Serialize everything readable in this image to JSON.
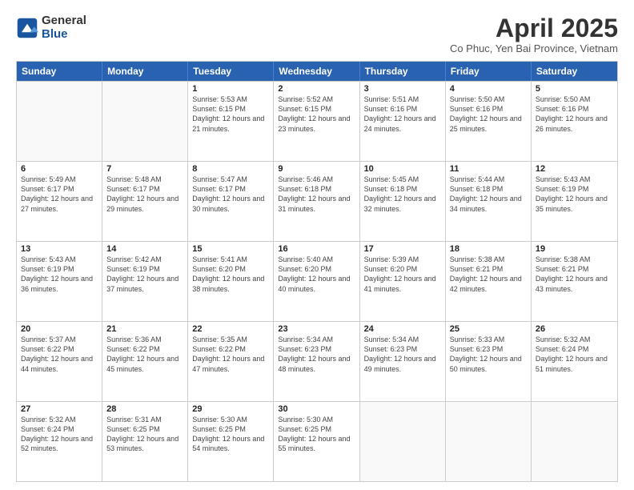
{
  "logo": {
    "general": "General",
    "blue": "Blue"
  },
  "title": "April 2025",
  "subtitle": "Co Phuc, Yen Bai Province, Vietnam",
  "headers": [
    "Sunday",
    "Monday",
    "Tuesday",
    "Wednesday",
    "Thursday",
    "Friday",
    "Saturday"
  ],
  "weeks": [
    [
      {
        "day": "",
        "info": ""
      },
      {
        "day": "",
        "info": ""
      },
      {
        "day": "1",
        "info": "Sunrise: 5:53 AM\nSunset: 6:15 PM\nDaylight: 12 hours and 21 minutes."
      },
      {
        "day": "2",
        "info": "Sunrise: 5:52 AM\nSunset: 6:15 PM\nDaylight: 12 hours and 23 minutes."
      },
      {
        "day": "3",
        "info": "Sunrise: 5:51 AM\nSunset: 6:16 PM\nDaylight: 12 hours and 24 minutes."
      },
      {
        "day": "4",
        "info": "Sunrise: 5:50 AM\nSunset: 6:16 PM\nDaylight: 12 hours and 25 minutes."
      },
      {
        "day": "5",
        "info": "Sunrise: 5:50 AM\nSunset: 6:16 PM\nDaylight: 12 hours and 26 minutes."
      }
    ],
    [
      {
        "day": "6",
        "info": "Sunrise: 5:49 AM\nSunset: 6:17 PM\nDaylight: 12 hours and 27 minutes."
      },
      {
        "day": "7",
        "info": "Sunrise: 5:48 AM\nSunset: 6:17 PM\nDaylight: 12 hours and 29 minutes."
      },
      {
        "day": "8",
        "info": "Sunrise: 5:47 AM\nSunset: 6:17 PM\nDaylight: 12 hours and 30 minutes."
      },
      {
        "day": "9",
        "info": "Sunrise: 5:46 AM\nSunset: 6:18 PM\nDaylight: 12 hours and 31 minutes."
      },
      {
        "day": "10",
        "info": "Sunrise: 5:45 AM\nSunset: 6:18 PM\nDaylight: 12 hours and 32 minutes."
      },
      {
        "day": "11",
        "info": "Sunrise: 5:44 AM\nSunset: 6:18 PM\nDaylight: 12 hours and 34 minutes."
      },
      {
        "day": "12",
        "info": "Sunrise: 5:43 AM\nSunset: 6:19 PM\nDaylight: 12 hours and 35 minutes."
      }
    ],
    [
      {
        "day": "13",
        "info": "Sunrise: 5:43 AM\nSunset: 6:19 PM\nDaylight: 12 hours and 36 minutes."
      },
      {
        "day": "14",
        "info": "Sunrise: 5:42 AM\nSunset: 6:19 PM\nDaylight: 12 hours and 37 minutes."
      },
      {
        "day": "15",
        "info": "Sunrise: 5:41 AM\nSunset: 6:20 PM\nDaylight: 12 hours and 38 minutes."
      },
      {
        "day": "16",
        "info": "Sunrise: 5:40 AM\nSunset: 6:20 PM\nDaylight: 12 hours and 40 minutes."
      },
      {
        "day": "17",
        "info": "Sunrise: 5:39 AM\nSunset: 6:20 PM\nDaylight: 12 hours and 41 minutes."
      },
      {
        "day": "18",
        "info": "Sunrise: 5:38 AM\nSunset: 6:21 PM\nDaylight: 12 hours and 42 minutes."
      },
      {
        "day": "19",
        "info": "Sunrise: 5:38 AM\nSunset: 6:21 PM\nDaylight: 12 hours and 43 minutes."
      }
    ],
    [
      {
        "day": "20",
        "info": "Sunrise: 5:37 AM\nSunset: 6:22 PM\nDaylight: 12 hours and 44 minutes."
      },
      {
        "day": "21",
        "info": "Sunrise: 5:36 AM\nSunset: 6:22 PM\nDaylight: 12 hours and 45 minutes."
      },
      {
        "day": "22",
        "info": "Sunrise: 5:35 AM\nSunset: 6:22 PM\nDaylight: 12 hours and 47 minutes."
      },
      {
        "day": "23",
        "info": "Sunrise: 5:34 AM\nSunset: 6:23 PM\nDaylight: 12 hours and 48 minutes."
      },
      {
        "day": "24",
        "info": "Sunrise: 5:34 AM\nSunset: 6:23 PM\nDaylight: 12 hours and 49 minutes."
      },
      {
        "day": "25",
        "info": "Sunrise: 5:33 AM\nSunset: 6:23 PM\nDaylight: 12 hours and 50 minutes."
      },
      {
        "day": "26",
        "info": "Sunrise: 5:32 AM\nSunset: 6:24 PM\nDaylight: 12 hours and 51 minutes."
      }
    ],
    [
      {
        "day": "27",
        "info": "Sunrise: 5:32 AM\nSunset: 6:24 PM\nDaylight: 12 hours and 52 minutes."
      },
      {
        "day": "28",
        "info": "Sunrise: 5:31 AM\nSunset: 6:25 PM\nDaylight: 12 hours and 53 minutes."
      },
      {
        "day": "29",
        "info": "Sunrise: 5:30 AM\nSunset: 6:25 PM\nDaylight: 12 hours and 54 minutes."
      },
      {
        "day": "30",
        "info": "Sunrise: 5:30 AM\nSunset: 6:25 PM\nDaylight: 12 hours and 55 minutes."
      },
      {
        "day": "",
        "info": ""
      },
      {
        "day": "",
        "info": ""
      },
      {
        "day": "",
        "info": ""
      }
    ]
  ]
}
